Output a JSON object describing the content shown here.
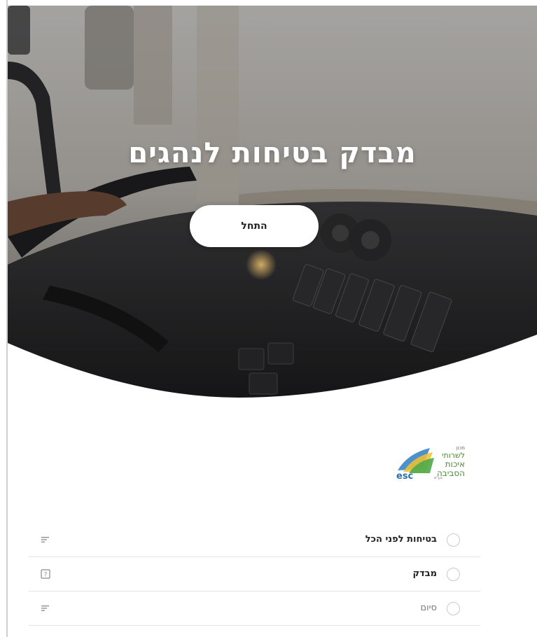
{
  "hero": {
    "title": "מבדק בטיחות לנהגים",
    "start_label": "התחל"
  },
  "logo": {
    "text_small": "מכון",
    "text_line1": "לשרותי",
    "text_line2": "איכות",
    "text_line3": "הסביבה",
    "mark": "esc",
    "suffix": "בע\"מ"
  },
  "steps": [
    {
      "label": "בטיחות לפני הכל",
      "type_icon": "lines-icon"
    },
    {
      "label": "מבדק",
      "type_icon": "question-box-icon"
    },
    {
      "label": "סיום",
      "type_icon": "lines-icon"
    }
  ],
  "colors": {
    "accent_white": "#ffffff",
    "divider": "#e3e3e3",
    "radio_border": "#c9c9c9"
  }
}
